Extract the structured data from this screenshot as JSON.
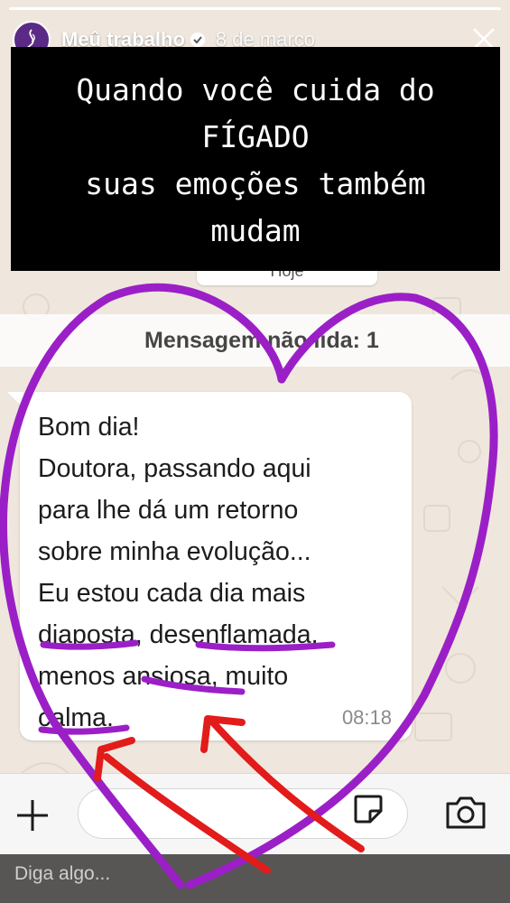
{
  "story": {
    "account_name": "Meû trabalho",
    "date": "8 de março",
    "progress": 1.0
  },
  "caption": {
    "line1": "Quando você cuida do",
    "line2": "FÍGADO",
    "line3": "suas emoções também",
    "line4": "mudam"
  },
  "chat": {
    "today_label": "Hoje",
    "unread_banner": "Mensagem não lida: 1",
    "message": {
      "text": "Bom dia!\nDoutora, passando aqui\npara lhe dá um retorno\nsobre minha evolução...\nEu estou cada dia mais\ndiaposta, desenflamada,\nmenos ansiosa, muito\ncalma.",
      "time": "08:18"
    }
  },
  "reply": {
    "placeholder": "Diga algo..."
  },
  "colors": {
    "drawing_purple": "#9b1fc7",
    "drawing_red": "#e21b1b",
    "chat_background": "#efe7dd"
  },
  "icons": [
    "close-icon",
    "verified-icon",
    "plus-icon",
    "sticker-icon",
    "camera-icon"
  ]
}
